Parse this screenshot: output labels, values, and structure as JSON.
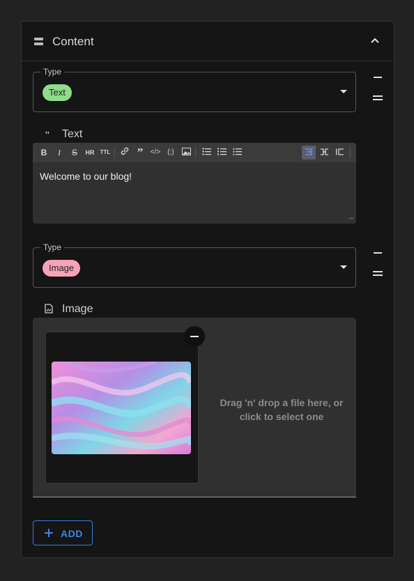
{
  "panel": {
    "title": "Content",
    "icon": "list-bars-icon",
    "collapse_icon": "chevron-up-icon"
  },
  "blocks": [
    {
      "type_legend": "Type",
      "type_value": "Text",
      "type_chip_color": "#8fdc8c",
      "field_label": "Text",
      "field_icon": "quote-icon",
      "editor_content": "Welcome to our blog!",
      "toolbar": [
        {
          "name": "bold",
          "glyph": "B"
        },
        {
          "name": "italic",
          "glyph": "I"
        },
        {
          "name": "strikethrough",
          "glyph": "S"
        },
        {
          "name": "horizontal-rule",
          "glyph": "HR"
        },
        {
          "name": "title",
          "glyph": "TTL"
        },
        {
          "name": "link",
          "glyph": "🔗"
        },
        {
          "name": "blockquote",
          "glyph": "❞"
        },
        {
          "name": "code",
          "glyph": "</>"
        },
        {
          "name": "code-block",
          "glyph": "{;}"
        },
        {
          "name": "image",
          "glyph": "🖼"
        },
        {
          "name": "bullet-list",
          "glyph": "☰"
        },
        {
          "name": "numbered-list",
          "glyph": "☷"
        },
        {
          "name": "check-list",
          "glyph": "☑"
        },
        {
          "name": "edit-mode",
          "glyph": "✎"
        },
        {
          "name": "split-mode",
          "glyph": "⊐⊏"
        },
        {
          "name": "preview-mode",
          "glyph": "⊏"
        }
      ],
      "active_tool": "edit-mode"
    },
    {
      "type_legend": "Type",
      "type_value": "Image",
      "type_chip_color": "#f6a3b9",
      "field_label": "Image",
      "field_icon": "file-image-icon",
      "dropzone_hint": "Drag 'n' drop a file here, or click to select one"
    }
  ],
  "add_button": {
    "label": "ADD",
    "color": "#3f86ea"
  }
}
